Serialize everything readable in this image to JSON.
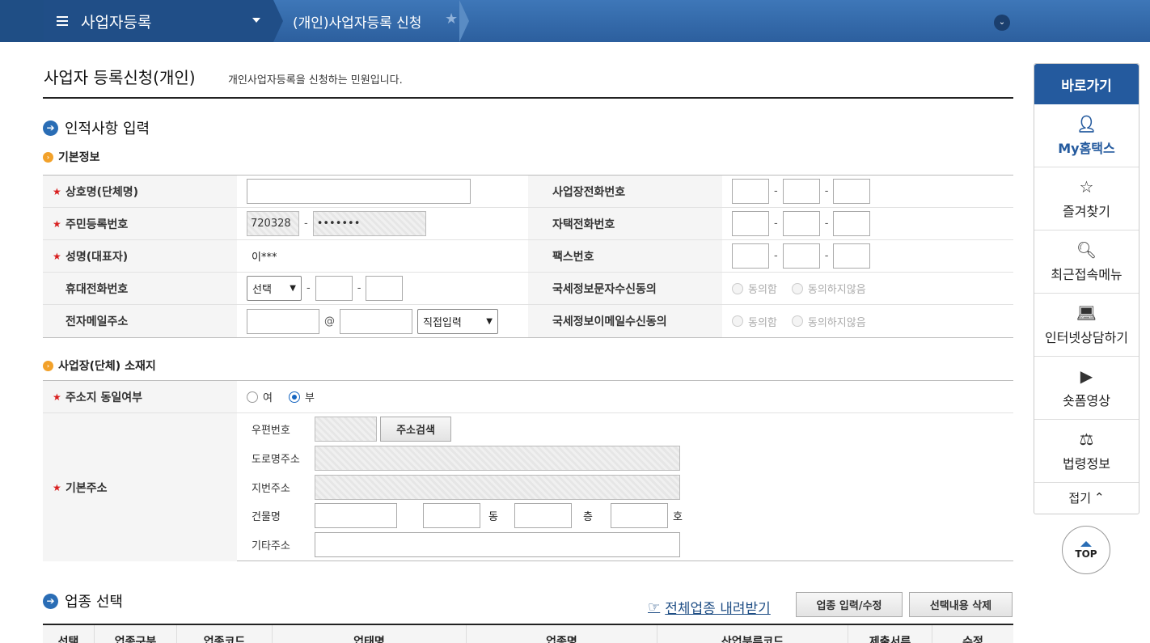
{
  "nav": {
    "menu_title": "사업자등록",
    "breadcrumb": "(개인)사업자등록 신청"
  },
  "page": {
    "title": "사업자 등록신청(개인)",
    "desc": "개인사업자등록을 신청하는 민원입니다."
  },
  "section1": {
    "title": "인적사항 입력",
    "basic_title": "기본정보",
    "fields": {
      "biz_name": "상호명(단체명)",
      "resident_no": "주민등록번호",
      "resident_front": "720328",
      "resident_back": "•••••••",
      "name": "성명(대표자)",
      "name_value": "이***",
      "mobile": "휴대전화번호",
      "mobile_select": "선택",
      "email": "전자메일주소",
      "email_at": "@",
      "email_select": "직접입력",
      "biz_phone": "사업장전화번호",
      "home_phone": "자택전화번호",
      "fax": "팩스번호",
      "sms_consent": "국세정보문자수신동의",
      "email_consent": "국세정보이메일수신동의",
      "agree": "동의함",
      "disagree": "동의하지않음"
    },
    "dash": "-"
  },
  "section2": {
    "title": "사업장(단체) 소재지",
    "same_address": "주소지 동일여부",
    "yes": "여",
    "no": "부",
    "base_address": "기본주소",
    "postal": "우편번호",
    "search_btn": "주소검색",
    "road": "도로명주소",
    "lot": "지번주소",
    "building": "건물명",
    "dong": "동",
    "floor": "층",
    "ho": "호",
    "etc": "기타주소"
  },
  "section3": {
    "title": "업종 선택",
    "download": "전체업종 내려받기",
    "btn_edit": "업종 입력/수정",
    "btn_delete": "선택내용 삭제",
    "columns": [
      "선택",
      "업종구분",
      "업종코드",
      "업태명",
      "업종명",
      "산업분류코드",
      "제출서류",
      "수정"
    ]
  },
  "quick": {
    "head": "바로가기",
    "items": [
      "My홈택스",
      "즐겨찾기",
      "최근접속메뉴",
      "인터넷상담하기",
      "숏폼영상",
      "법령정보"
    ],
    "fold": "접기",
    "top": "TOP"
  }
}
